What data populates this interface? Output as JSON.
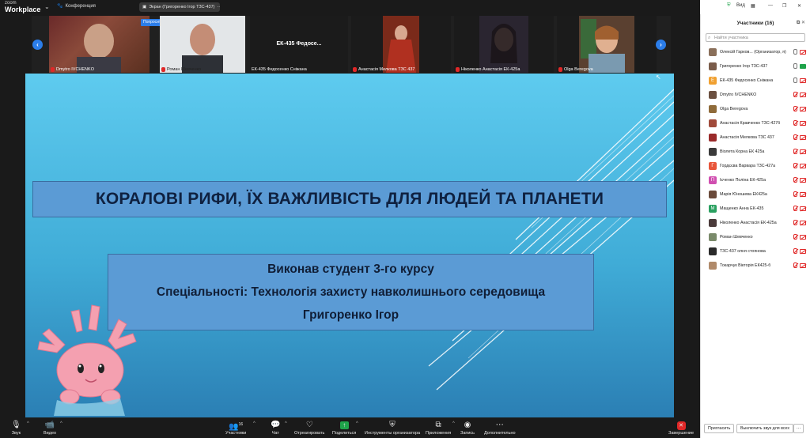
{
  "app": {
    "brand_top": "zoom",
    "brand_bottom": "Workplace",
    "conference": "Конференция",
    "share_label": "Экран (Григоренко Ігор ТЗС-437)",
    "view_label": "Вид"
  },
  "strip": {
    "ask_btn": "Попросить вкл",
    "tiles": [
      {
        "name": "Dmytro IVCHENKO"
      },
      {
        "name": "Роман Шевченко"
      },
      {
        "name": "ЕК-435 Федосенко Сніжана",
        "center": "ЕК-435  Федосе..."
      },
      {
        "name": "Анастасія Мелкова ТЗС 437"
      },
      {
        "name": "Ніколенко Анастасія ЕК-425а"
      },
      {
        "name": "Olga Beregova"
      }
    ]
  },
  "slide": {
    "title": "КОРАЛОВІ РИФИ, ЇХ ВАЖЛИВІСТЬ ДЛЯ ЛЮДЕЙ ТА ПЛАНЕТИ",
    "line1": "Виконав студент 3-го курсу",
    "line2": "Спеціальності: Технологія захисту навколишнього середовища",
    "line3": "Григоренко Ігор"
  },
  "toolbar": {
    "audio": "Звук",
    "video": "Видео",
    "participants": "Участники",
    "participants_count": "16",
    "chat": "Чат",
    "react": "Отреагировать",
    "share": "Поделиться",
    "host_tools": "Инструменты организатора",
    "apps": "Приложения",
    "record": "Запись",
    "more": "Дополнительно",
    "end": "Завершение"
  },
  "panel": {
    "title": "Участники (16)",
    "search_placeholder": "Найти участника",
    "invite": "Пригласить",
    "mute_all": "Выключить звук для всех",
    "participants": [
      {
        "name": "Олексій Гарков... (Организатор, я)",
        "color": "#8a6f5a",
        "letter": "",
        "mic": "on",
        "cam": "off"
      },
      {
        "name": "Григоренко Ігор ТЗС-437",
        "color": "#7a5c4a",
        "letter": "",
        "mic": "on",
        "cam": "on"
      },
      {
        "name": "ЕК-435 Федосенко Сніжана",
        "color": "#f0a030",
        "letter": "Е",
        "mic": "on",
        "cam": "off"
      },
      {
        "name": "Dmytro IVCHENKO",
        "color": "#6b5040",
        "letter": "",
        "mic": "off",
        "cam": "off"
      },
      {
        "name": "Olga Beregova",
        "color": "#8f6b3a",
        "letter": "",
        "mic": "off",
        "cam": "off"
      },
      {
        "name": "Анастасія Кравченко ТЗС-427б",
        "color": "#a04a3a",
        "letter": "",
        "mic": "off",
        "cam": "off"
      },
      {
        "name": "Анастасія Мелкова ТЗС 437",
        "color": "#9a2a2a",
        "letter": "",
        "mic": "off",
        "cam": "off"
      },
      {
        "name": "Віолета Корна ЕК 425а",
        "color": "#3a3a3a",
        "letter": "",
        "mic": "off",
        "cam": "off"
      },
      {
        "name": "Гордєєва Варвара ТЗС-427а",
        "color": "#e8553a",
        "letter": "Г",
        "mic": "off",
        "cam": "off"
      },
      {
        "name": "Ієченко Поліна ЕК-425а",
        "color": "#d04fb0",
        "letter": "П",
        "mic": "off",
        "cam": "off"
      },
      {
        "name": "Марія Юношева ЕК425а",
        "color": "#6a4a3a",
        "letter": "",
        "mic": "off",
        "cam": "off"
      },
      {
        "name": "Мащенко Анна ЕК-435",
        "color": "#2aa060",
        "letter": "М",
        "mic": "off",
        "cam": "off"
      },
      {
        "name": "Ніколенко Анастасія ЕК-425а",
        "color": "#4a3a3a",
        "letter": "",
        "mic": "off",
        "cam": "off"
      },
      {
        "name": "Роман Шевченко",
        "color": "#7a8a6a",
        "letter": "",
        "mic": "off",
        "cam": "off"
      },
      {
        "name": "ТЗС-437 олня стоянова",
        "color": "#2a2a2a",
        "letter": "",
        "mic": "off",
        "cam": "off"
      },
      {
        "name": "Токарчук Вікторія ЕК425-б",
        "color": "#b08a6a",
        "letter": "",
        "mic": "off",
        "cam": "off"
      }
    ]
  }
}
